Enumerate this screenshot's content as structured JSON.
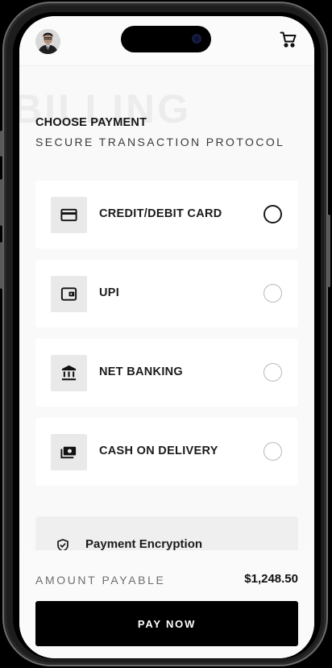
{
  "header": {
    "avatar_icon": "user-avatar",
    "cart_icon": "cart-icon"
  },
  "page": {
    "watermark": "BILLING",
    "title": "CHOOSE PAYMENT",
    "subtitle": "SECURE TRANSACTION PROTOCOL"
  },
  "payment_options": [
    {
      "label": "CREDIT/DEBIT CARD",
      "icon": "credit-card-icon",
      "selected": true
    },
    {
      "label": "UPI",
      "icon": "wallet-icon",
      "selected": false
    },
    {
      "label": "NET BANKING",
      "icon": "bank-icon",
      "selected": false
    },
    {
      "label": "CASH ON DELIVERY",
      "icon": "cash-icon",
      "selected": false
    }
  ],
  "encryption": {
    "label": "Payment Encryption",
    "icon": "shield-check-icon"
  },
  "footer": {
    "amount_label": "AMOUNT PAYABLE",
    "amount_value": "$1,248.50",
    "pay_button": "PAY NOW"
  },
  "colors": {
    "background": "#f9f9f9",
    "card": "#ffffff",
    "primary": "#000000"
  }
}
